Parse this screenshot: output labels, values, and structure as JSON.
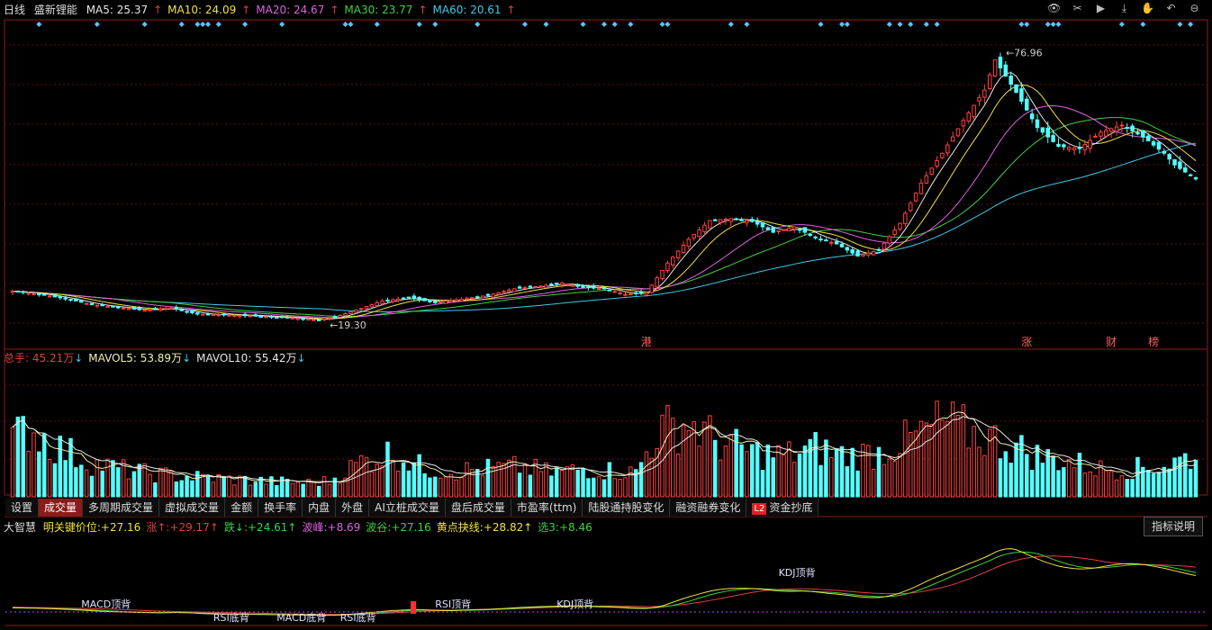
{
  "header": {
    "period": "日线",
    "stock_name": "盛新锂能",
    "ma": [
      {
        "label": "MA5: 25.37",
        "arrow": "↑",
        "color": "#e6e6e6"
      },
      {
        "label": "MA10: 24.09",
        "arrow": "↑",
        "color": "#f0e040"
      },
      {
        "label": "MA20: 24.67",
        "arrow": "↑",
        "color": "#e060e0"
      },
      {
        "label": "MA30: 23.77",
        "arrow": "↑",
        "color": "#40d040"
      },
      {
        "label": "MA60: 20.61",
        "arrow": "↑",
        "color": "#40c8e8"
      }
    ],
    "tool_icons": [
      "eye-icon",
      "scissors-icon",
      "play-icon",
      "download-icon",
      "hand-icon",
      "undo-icon",
      "minus-circle-icon"
    ]
  },
  "price_chart": {
    "high_label": "76.96",
    "low_label": "19.30",
    "event_markers": [
      {
        "text": "港",
        "x_index": 120
      },
      {
        "text": "涨",
        "x_index": 192
      },
      {
        "text": "财",
        "x_index": 208
      },
      {
        "text": "榜",
        "x_index": 216
      }
    ],
    "ylim": [
      15,
      82
    ]
  },
  "volume": {
    "legend": [
      {
        "label": "总手: 45.21万",
        "arrow": "↓",
        "color": "#e04040"
      },
      {
        "label": "MAVOL5: 53.89万",
        "arrow": "↓",
        "color": "#f0f0b0"
      },
      {
        "label": "MAVOL10: 55.42万",
        "arrow": "↓",
        "color": "#e6e6e6"
      }
    ]
  },
  "tabs": [
    {
      "label": "设置",
      "active": false
    },
    {
      "label": "成交量",
      "active": true
    },
    {
      "label": "多周期成交量",
      "active": false
    },
    {
      "label": "虚拟成交量",
      "active": false
    },
    {
      "label": "金额",
      "active": false
    },
    {
      "label": "换手率",
      "active": false
    },
    {
      "label": "内盘",
      "active": false
    },
    {
      "label": "外盘",
      "active": false
    },
    {
      "label": "AI立桩成交量",
      "active": false
    },
    {
      "label": "盘后成交量",
      "active": false
    },
    {
      "label": "市盈率(ttm)",
      "active": false
    },
    {
      "label": "陆股通持股变化",
      "active": false
    },
    {
      "label": "融资融券变化",
      "active": false
    },
    {
      "label": "资金抄底",
      "active": false,
      "badge": "L2"
    }
  ],
  "indicator": {
    "name": "大智慧",
    "items": [
      {
        "label": "明关键价位:",
        "value": "+27.16",
        "suffix": "",
        "color": "#f0e040"
      },
      {
        "label": "涨↑:",
        "value": "+29.17",
        "suffix": "↑",
        "color": "#e04040"
      },
      {
        "label": "跌↓:",
        "value": "+24.61",
        "suffix": "↑",
        "color": "#40d040"
      },
      {
        "label": "波峰:",
        "value": "+8.69",
        "suffix": "",
        "color": "#e060e0"
      },
      {
        "label": "波谷:",
        "value": "+27.16",
        "suffix": "",
        "color": "#40d040"
      },
      {
        "label": "黄点抉线:",
        "value": "+28.82",
        "suffix": "↑",
        "color": "#f0e040"
      },
      {
        "label": "选3:",
        "value": "+8.46",
        "suffix": "",
        "color": "#40d040"
      }
    ],
    "explain_button": "指标说明",
    "annotations": [
      {
        "text": "MACD顶背",
        "x_index": 13,
        "row": 1
      },
      {
        "text": "RSI底背",
        "x_index": 38,
        "row": 2
      },
      {
        "text": "MACD底背",
        "x_index": 50,
        "row": 2
      },
      {
        "text": "RSI底背",
        "x_index": 62,
        "row": 2
      },
      {
        "text": "RSI顶背",
        "x_index": 80,
        "row": 1
      },
      {
        "text": "KDJ顶背",
        "x_index": 103,
        "row": 1
      },
      {
        "text": "KDJ顶背",
        "x_index": 145,
        "row": 0
      }
    ]
  },
  "chart_data": {
    "type": "candlestick",
    "ma_periods": [
      5,
      10,
      20,
      30,
      60
    ],
    "series_colors": {
      "up": "#ff4040",
      "down": "#54ffff",
      "ma5": "#e6e6e6",
      "ma10": "#f0e040",
      "ma20": "#e060e0",
      "ma30": "#40d040",
      "ma60": "#40c8e8"
    },
    "anchors": [
      [
        0,
        25.5
      ],
      [
        5,
        24.8
      ],
      [
        10,
        23.9
      ],
      [
        15,
        22.6
      ],
      [
        20,
        22.0
      ],
      [
        25,
        21.4
      ],
      [
        30,
        21.9
      ],
      [
        35,
        20.6
      ],
      [
        40,
        20.4
      ],
      [
        45,
        20.2
      ],
      [
        50,
        19.9
      ],
      [
        55,
        19.6
      ],
      [
        58,
        19.3
      ],
      [
        62,
        20.3
      ],
      [
        66,
        21.8
      ],
      [
        70,
        23.4
      ],
      [
        75,
        24.1
      ],
      [
        80,
        23.0
      ],
      [
        85,
        23.8
      ],
      [
        90,
        24.6
      ],
      [
        95,
        26.0
      ],
      [
        100,
        26.6
      ],
      [
        104,
        27.2
      ],
      [
        108,
        26.3
      ],
      [
        112,
        26.0
      ],
      [
        116,
        24.8
      ],
      [
        120,
        25.2
      ],
      [
        124,
        31.5
      ],
      [
        128,
        36.6
      ],
      [
        132,
        40.6
      ],
      [
        136,
        41.0
      ],
      [
        140,
        40.4
      ],
      [
        144,
        38.1
      ],
      [
        148,
        39.2
      ],
      [
        152,
        37.0
      ],
      [
        156,
        35.6
      ],
      [
        160,
        33.0
      ],
      [
        164,
        34.3
      ],
      [
        168,
        40.0
      ],
      [
        172,
        48.6
      ],
      [
        176,
        55.0
      ],
      [
        180,
        62.0
      ],
      [
        184,
        68.5
      ],
      [
        186,
        75.0
      ],
      [
        190,
        68.0
      ],
      [
        194,
        60.5
      ],
      [
        198,
        56.5
      ],
      [
        202,
        56.0
      ],
      [
        206,
        59.5
      ],
      [
        210,
        61.0
      ],
      [
        214,
        58.5
      ],
      [
        218,
        55.0
      ],
      [
        220,
        52.5
      ],
      [
        224,
        49.5
      ]
    ],
    "volume_anchors": [
      [
        0,
        60
      ],
      [
        3,
        75
      ],
      [
        8,
        55
      ],
      [
        14,
        38
      ],
      [
        20,
        30
      ],
      [
        26,
        25
      ],
      [
        32,
        22
      ],
      [
        38,
        20
      ],
      [
        44,
        18
      ],
      [
        50,
        16
      ],
      [
        56,
        15
      ],
      [
        60,
        17
      ],
      [
        66,
        38
      ],
      [
        72,
        48
      ],
      [
        78,
        30
      ],
      [
        84,
        28
      ],
      [
        90,
        30
      ],
      [
        96,
        32
      ],
      [
        102,
        26
      ],
      [
        108,
        30
      ],
      [
        114,
        28
      ],
      [
        118,
        26
      ],
      [
        122,
        70
      ],
      [
        128,
        80
      ],
      [
        134,
        58
      ],
      [
        140,
        48
      ],
      [
        146,
        44
      ],
      [
        152,
        52
      ],
      [
        158,
        44
      ],
      [
        164,
        48
      ],
      [
        170,
        62
      ],
      [
        176,
        80
      ],
      [
        182,
        68
      ],
      [
        188,
        58
      ],
      [
        194,
        44
      ],
      [
        200,
        38
      ],
      [
        206,
        30
      ],
      [
        212,
        30
      ],
      [
        218,
        34
      ],
      [
        224,
        45
      ]
    ],
    "volume_ylim": [
      0,
      140
    ],
    "volume_unit": "万"
  }
}
